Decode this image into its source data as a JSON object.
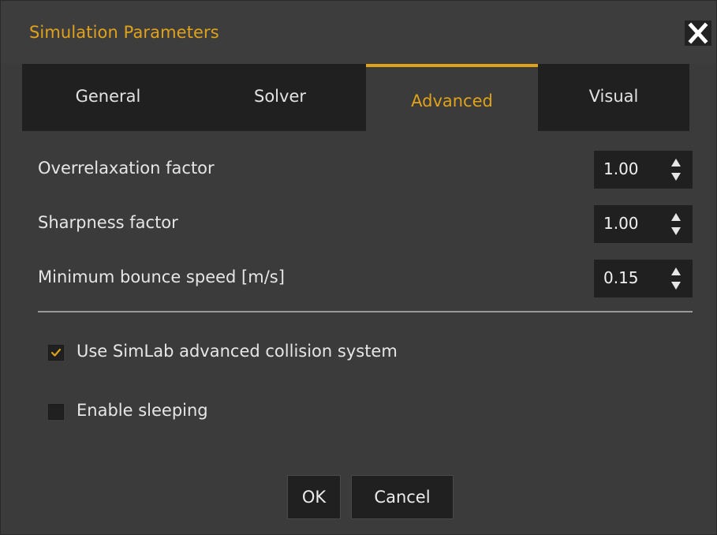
{
  "window": {
    "title": "Simulation Parameters",
    "close_symbol": "✕"
  },
  "tabs": [
    {
      "label": "General",
      "active": false
    },
    {
      "label": "Solver",
      "active": false
    },
    {
      "label": "Advanced",
      "active": true
    },
    {
      "label": "Visual",
      "active": false
    }
  ],
  "params": [
    {
      "label": "Overrelaxation factor",
      "value": "1.00"
    },
    {
      "label": "Sharpness factor",
      "value": "1.00"
    },
    {
      "label": "Minimum bounce speed [m/s]",
      "value": "0.15"
    }
  ],
  "options": [
    {
      "label": "Use SimLab advanced collision system",
      "checked": true
    },
    {
      "label": "Enable sleeping",
      "checked": false
    }
  ],
  "buttons": {
    "ok_label": "OK",
    "cancel_label": "Cancel"
  },
  "colors": {
    "accent": "#e0a21b",
    "background": "#3b3b3b",
    "field": "#202020",
    "text": "#e6e6e6"
  },
  "icons": {
    "close": "close-icon",
    "spin_up": "arrow-up-icon",
    "spin_down": "arrow-down-icon",
    "check": "checkmark-icon"
  }
}
